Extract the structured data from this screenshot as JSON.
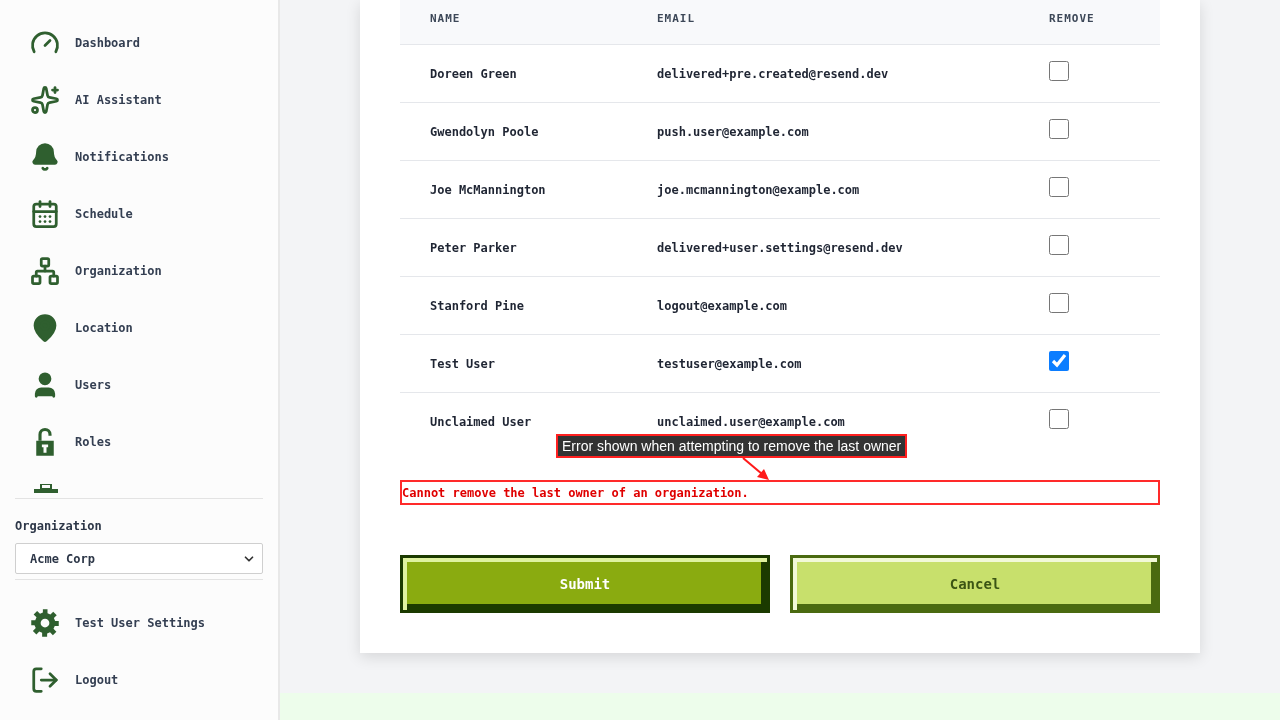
{
  "sidebar": {
    "nav_items": [
      {
        "label": "Dashboard",
        "selected": false
      },
      {
        "label": "AI Assistant",
        "selected": false
      },
      {
        "label": "Notifications",
        "selected": false
      },
      {
        "label": "Schedule",
        "selected": false
      },
      {
        "label": "Organization",
        "selected": false
      },
      {
        "label": "Location",
        "selected": false
      },
      {
        "label": "Users",
        "selected": false
      },
      {
        "label": "Roles",
        "selected": false
      }
    ],
    "organization": {
      "label": "Organization",
      "value": "Acme Corp"
    },
    "footer_items": [
      {
        "label": "Test User Settings"
      },
      {
        "label": "Logout"
      }
    ]
  },
  "members_table": {
    "columns": [
      "NAME",
      "EMAIL",
      "REMOVE"
    ],
    "rows": [
      {
        "name": "Doreen Green",
        "email": "delivered+pre.created@resend.dev",
        "checked": false
      },
      {
        "name": "Gwendolyn Poole",
        "email": "push.user@example.com",
        "checked": false
      },
      {
        "name": "Joe McMannington",
        "email": "joe.mcmannington@example.com",
        "checked": false
      },
      {
        "name": "Peter Parker",
        "email": "delivered+user.settings@resend.dev",
        "checked": false
      },
      {
        "name": "Stanford Pine",
        "email": "logout@example.com",
        "checked": false
      },
      {
        "name": "Test User",
        "email": "testuser@example.com",
        "checked": true
      },
      {
        "name": "Unclaimed User",
        "email": "unclaimed.user@example.com",
        "checked": false
      }
    ]
  },
  "error_message": "Cannot remove the last owner of an organization.",
  "annotation": {
    "label": "Error shown when attempting to remove the last owner"
  },
  "buttons": [
    {
      "label": "Submit",
      "kind": "primary"
    },
    {
      "label": "Cancel",
      "kind": "secondary"
    }
  ]
}
